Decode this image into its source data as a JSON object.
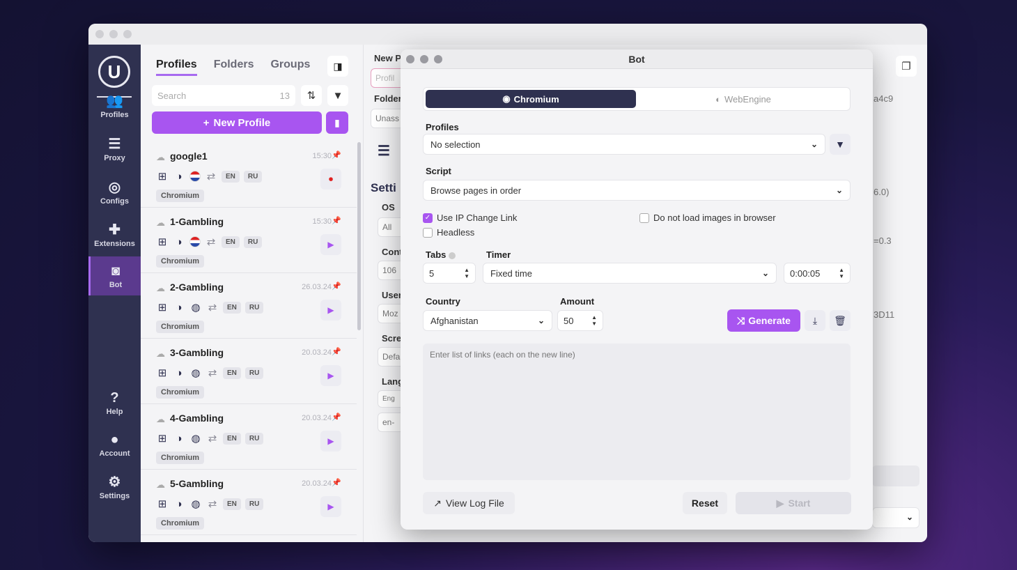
{
  "sidebar": {
    "items": [
      {
        "label": "Profiles",
        "icon": "users-icon",
        "glyph": "👥"
      },
      {
        "label": "Proxy",
        "icon": "server-icon",
        "glyph": "☰"
      },
      {
        "label": "Configs",
        "icon": "fingerprint-icon",
        "glyph": "◎"
      },
      {
        "label": "Extensions",
        "icon": "puzzle-icon",
        "glyph": "✚"
      },
      {
        "label": "Bot",
        "icon": "robot-icon",
        "glyph": "◙"
      },
      {
        "label": "Help",
        "icon": "help-icon",
        "glyph": "?"
      },
      {
        "label": "Account",
        "icon": "account-icon",
        "glyph": "●"
      },
      {
        "label": "Settings",
        "icon": "gear-icon",
        "glyph": "⚙"
      }
    ]
  },
  "profiles_panel": {
    "tabs": [
      "Profiles",
      "Folders",
      "Groups"
    ],
    "search_placeholder": "Search",
    "count": "13",
    "new_profile_label": "New Profile",
    "profiles": [
      {
        "name": "google1",
        "time": "15:30",
        "langs": [
          "EN",
          "RU"
        ],
        "browser": "Chromium",
        "running": true
      },
      {
        "name": "1-Gambling",
        "time": "15:30",
        "langs": [
          "EN",
          "RU"
        ],
        "browser": "Chromium",
        "running": false
      },
      {
        "name": "2-Gambling",
        "time": "26.03.24",
        "langs": [
          "EN",
          "RU"
        ],
        "browser": "Chromium",
        "running": false
      },
      {
        "name": "3-Gambling",
        "time": "20.03.24",
        "langs": [
          "EN",
          "RU"
        ],
        "browser": "Chromium",
        "running": false
      },
      {
        "name": "4-Gambling",
        "time": "20.03.24",
        "langs": [
          "EN",
          "RU"
        ],
        "browser": "Chromium",
        "running": false
      },
      {
        "name": "5-Gambling",
        "time": "20.03.24",
        "langs": [
          "EN",
          "RU"
        ],
        "browser": "Chromium",
        "running": false
      }
    ]
  },
  "editor_bg": {
    "new_profile": "New P",
    "profile_placeholder": "Profil",
    "folder": "Folder",
    "unassigned": "Unass",
    "settings": "Setti",
    "os": "OS",
    "os_value": "All",
    "cont": "Cont",
    "cont_value": "106",
    "user": "User",
    "user_value": "Moz",
    "screen": "Scre",
    "screen_value": "Defa",
    "lang": "Lang",
    "lang_tag": "Eng",
    "lang_value": "en-",
    "right_vals": [
      "a4c9",
      "6.0)",
      "=0.3",
      "3D11"
    ]
  },
  "dialog": {
    "title": "Bot",
    "engines": {
      "active": "Chromium",
      "inactive": "WebEngine"
    },
    "profiles_label": "Profiles",
    "profiles_value": "No selection",
    "script_label": "Script",
    "script_value": "Browse pages in order",
    "use_ip_change": "Use IP Change Link",
    "headless": "Headless",
    "no_images": "Do not load images in browser",
    "tabs_label": "Tabs",
    "tabs_value": "5",
    "timer_label": "Timer",
    "timer_value": "Fixed time",
    "timer_time": "0:00:05",
    "country_label": "Country",
    "country_value": "Afghanistan",
    "amount_label": "Amount",
    "amount_value": "50",
    "generate_label": "Generate",
    "links_placeholder": "Enter list of links (each on the new line)",
    "view_log_label": "View Log File",
    "reset_label": "Reset",
    "start_label": "Start"
  }
}
